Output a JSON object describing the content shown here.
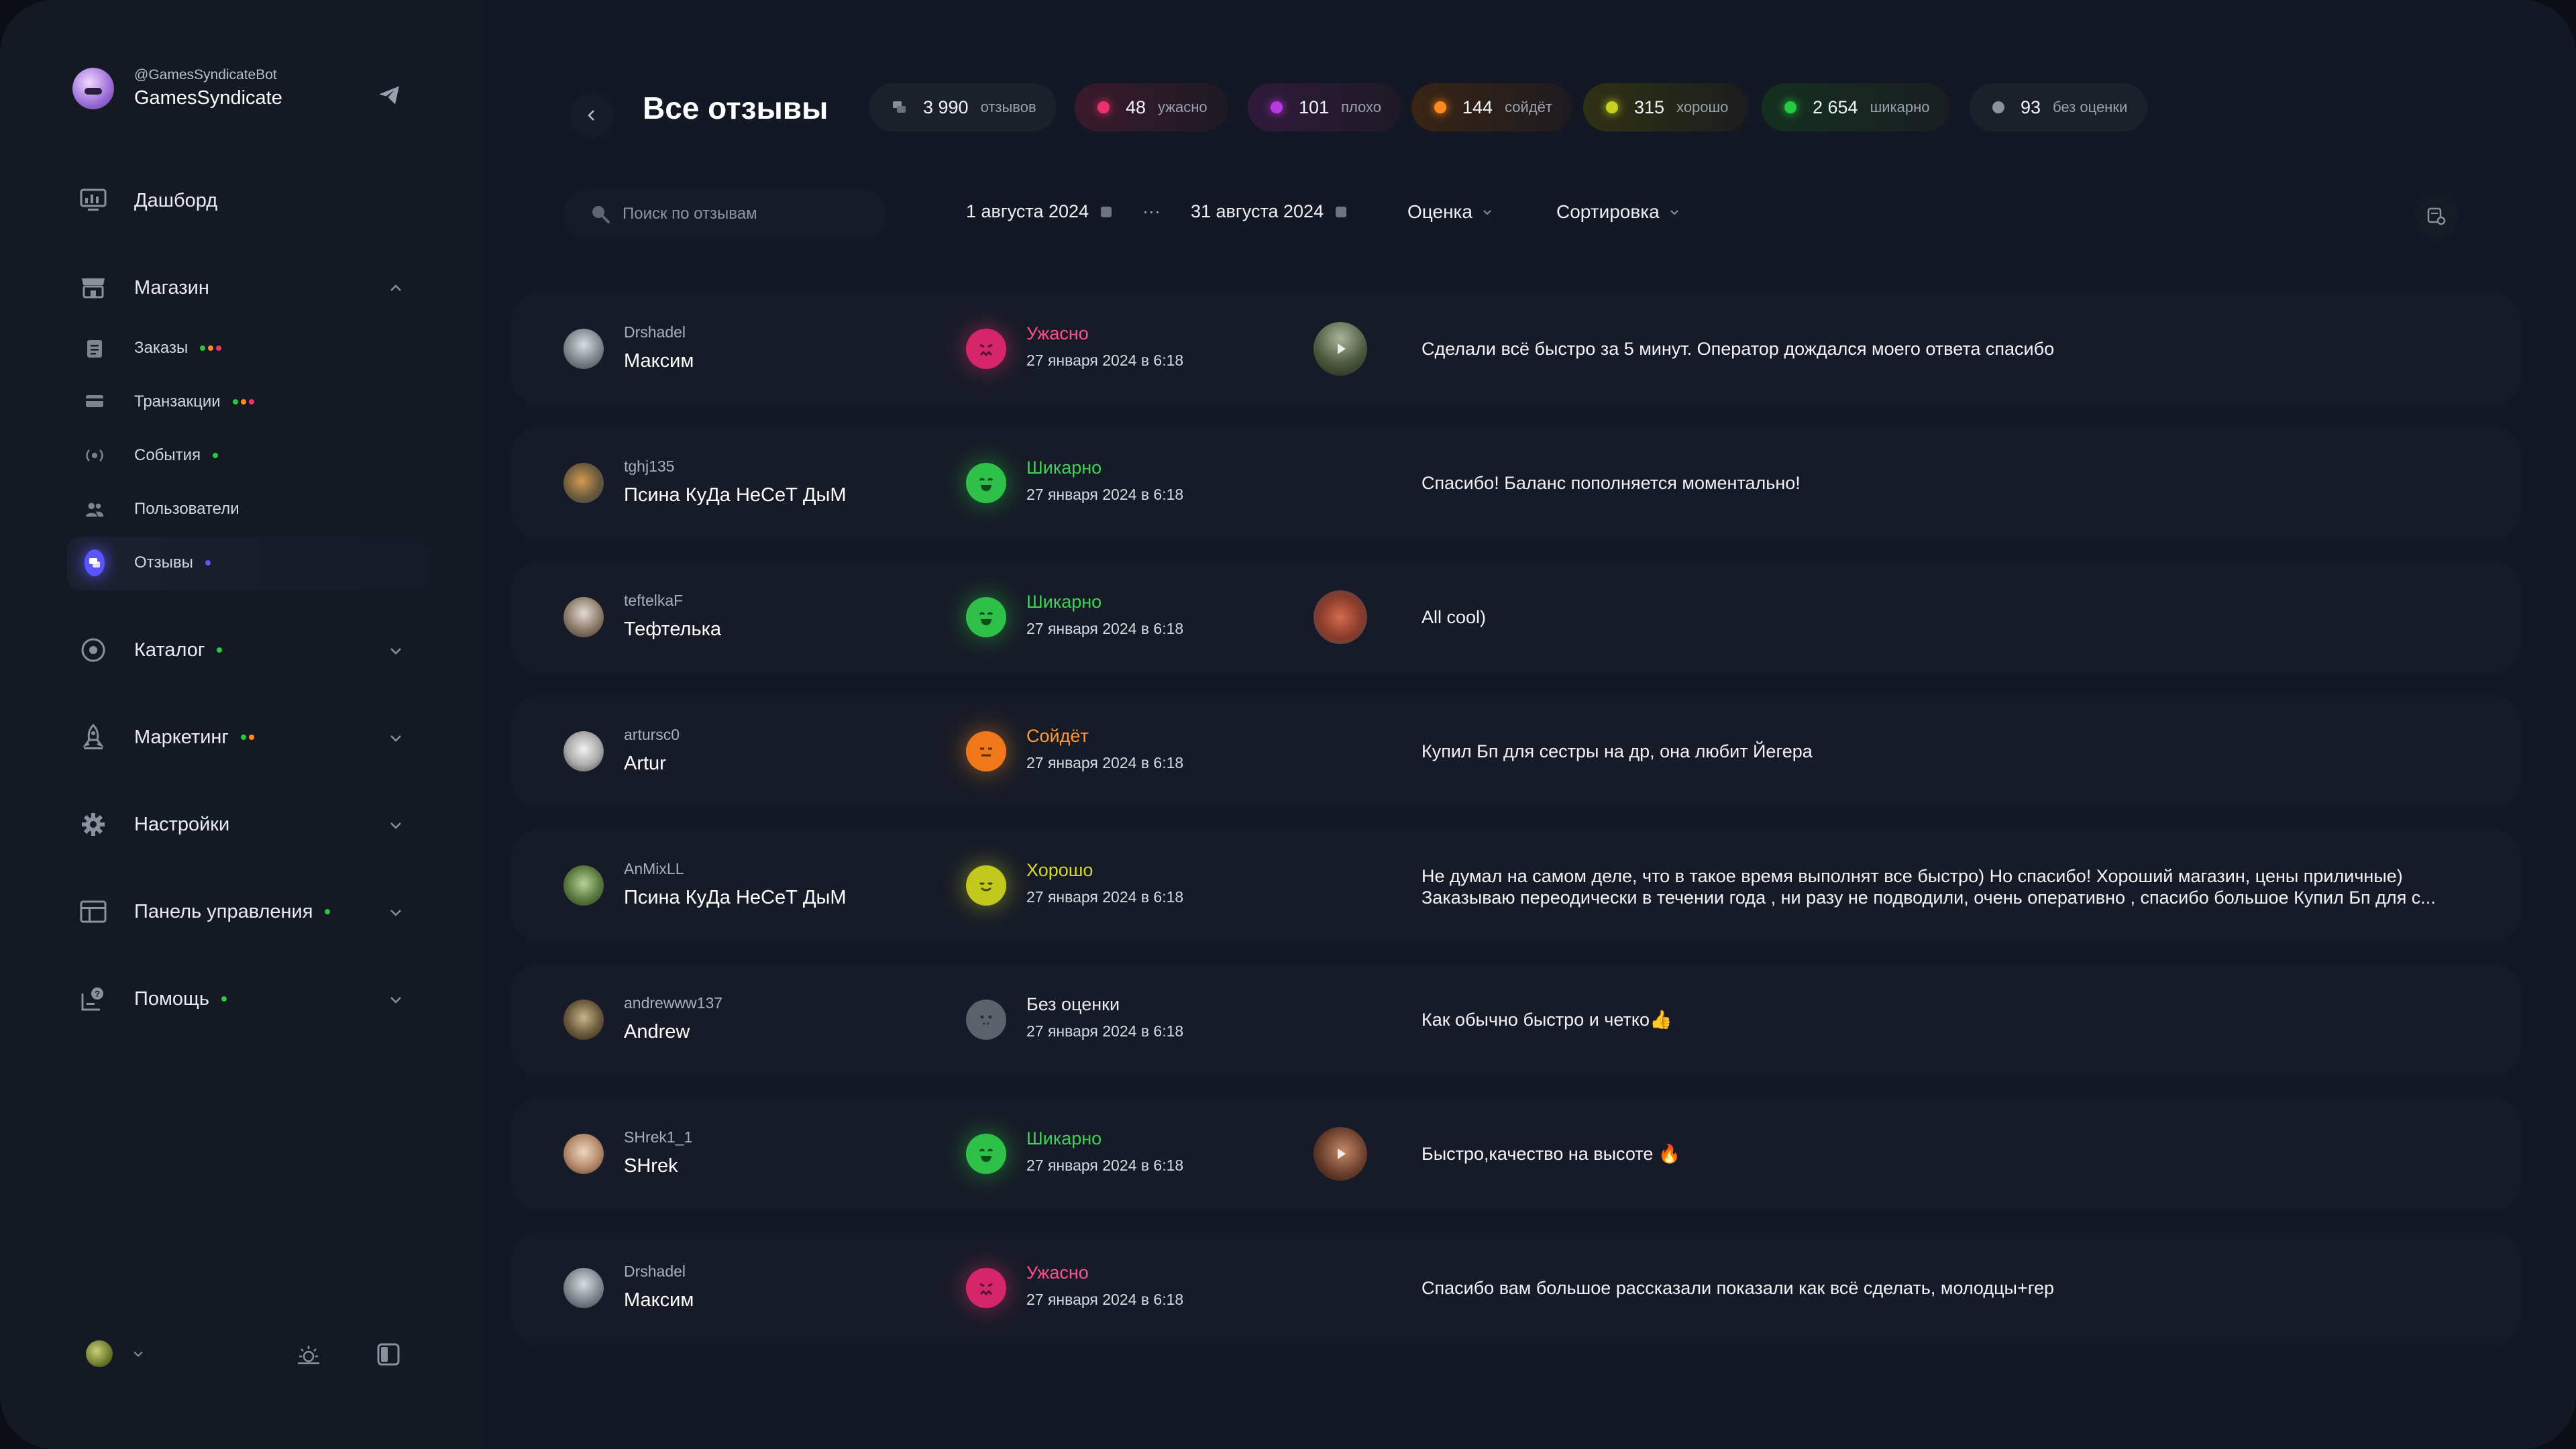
{
  "sidebar": {
    "bot_handle": "@GamesSyndicateBot",
    "shop_name": "GamesSyndicate",
    "items": [
      {
        "label": "Дашборд",
        "icon": "dashboard-icon"
      },
      {
        "label": "Магазин",
        "icon": "store-icon"
      },
      {
        "label": "Каталог",
        "icon": "catalog-icon"
      },
      {
        "label": "Маркетинг",
        "icon": "marketing-icon"
      },
      {
        "label": "Настройки",
        "icon": "gear-icon"
      },
      {
        "label": "Панель управления",
        "icon": "control-panel-icon"
      },
      {
        "label": "Помощь",
        "icon": "help-icon"
      }
    ],
    "store_subitems": [
      {
        "label": "Заказы",
        "icon": "orders-icon"
      },
      {
        "label": "Транзакции",
        "icon": "transactions-icon"
      },
      {
        "label": "События",
        "icon": "events-icon"
      },
      {
        "label": "Пользователи",
        "icon": "users-icon"
      },
      {
        "label": "Отзывы",
        "icon": "reviews-icon"
      }
    ]
  },
  "header": {
    "title": "Все отзывы",
    "stats": [
      {
        "value": "3 990",
        "label": "отзывов",
        "color": "#8a8f9a"
      },
      {
        "value": "48",
        "label": "ужасно",
        "color": "#e8336f"
      },
      {
        "value": "101",
        "label": "плохо",
        "color": "#b83be0"
      },
      {
        "value": "144",
        "label": "сойдёт",
        "color": "#ff8a1f"
      },
      {
        "value": "315",
        "label": "хорошо",
        "color": "#c9d11f"
      },
      {
        "value": "2 654",
        "label": "шикарно",
        "color": "#27c93f"
      },
      {
        "value": "93",
        "label": "без оценки",
        "color": "#8d929c"
      }
    ]
  },
  "filters": {
    "search_placeholder": "Поиск по отзывам",
    "date_from": "1 августа 2024",
    "date_sep": "···",
    "date_to": "31 августа 2024",
    "rating_label": "Оценка",
    "sort_label": "Сортировка"
  },
  "reviews": [
    {
      "handle": "Drshadel",
      "name": "Максим",
      "rating": "Ужасно",
      "rating_color": "#ff4f8b",
      "date": "27 января 2024 в 6:18",
      "text": "Сделали всё быстро за 5 минут. Оператор дождался моего ответа спасибо"
    },
    {
      "handle": "tghj135",
      "name": "Псина КуДа НеСеТ ДыМ",
      "rating": "Шикарно",
      "rating_color": "#3fd15a",
      "date": "27 января 2024 в 6:18",
      "text": "Спасибо! Баланс пополняется моментально!"
    },
    {
      "handle": "teftelkaF",
      "name": "Тефтелька",
      "rating": "Шикарно",
      "rating_color": "#3fd15a",
      "date": "27 января 2024 в 6:18",
      "text": "All cool)"
    },
    {
      "handle": "artursc0",
      "name": "Artur",
      "rating": "Сойдёт",
      "rating_color": "#ff9a2e",
      "date": "27 января 2024 в 6:18",
      "text": "Купил Бп для сестры на др, она любит Йегера"
    },
    {
      "handle": "AnMixLL",
      "name": "Псина КуДа НеСеТ ДыМ",
      "rating": "Хорошо",
      "rating_color": "#d3da2a",
      "date": "27 января 2024 в 6:18",
      "text": "Не думал на самом деле, что в такое время выполнят все быстро) Но спасибо! Хороший магазин, цены приличные)",
      "text2": "Заказываю переодически в течении года , ни разу не подводили, очень оперативно , спасибо большое Купил Бп для с..."
    },
    {
      "handle": "andrewww137",
      "name": "Andrew",
      "rating": "Без оценки",
      "rating_color": "#e8ebf0",
      "date": "27 января 2024 в 6:18",
      "text": "Как обычно быстро и четко👍"
    },
    {
      "handle": "SHrek1_1",
      "name": "SHrek",
      "rating": "Шикарно",
      "rating_color": "#3fd15a",
      "date": "27 января 2024 в 6:18",
      "text": "Быстро,качество на высоте 🔥"
    },
    {
      "handle": "Drshadel",
      "name": "Максим",
      "rating": "Ужасно",
      "rating_color": "#ff4f8b",
      "date": "27 января 2024 в 6:18",
      "text": "Спасибо вам большое рассказали показали как всё сделать, молодцы+гер"
    }
  ]
}
